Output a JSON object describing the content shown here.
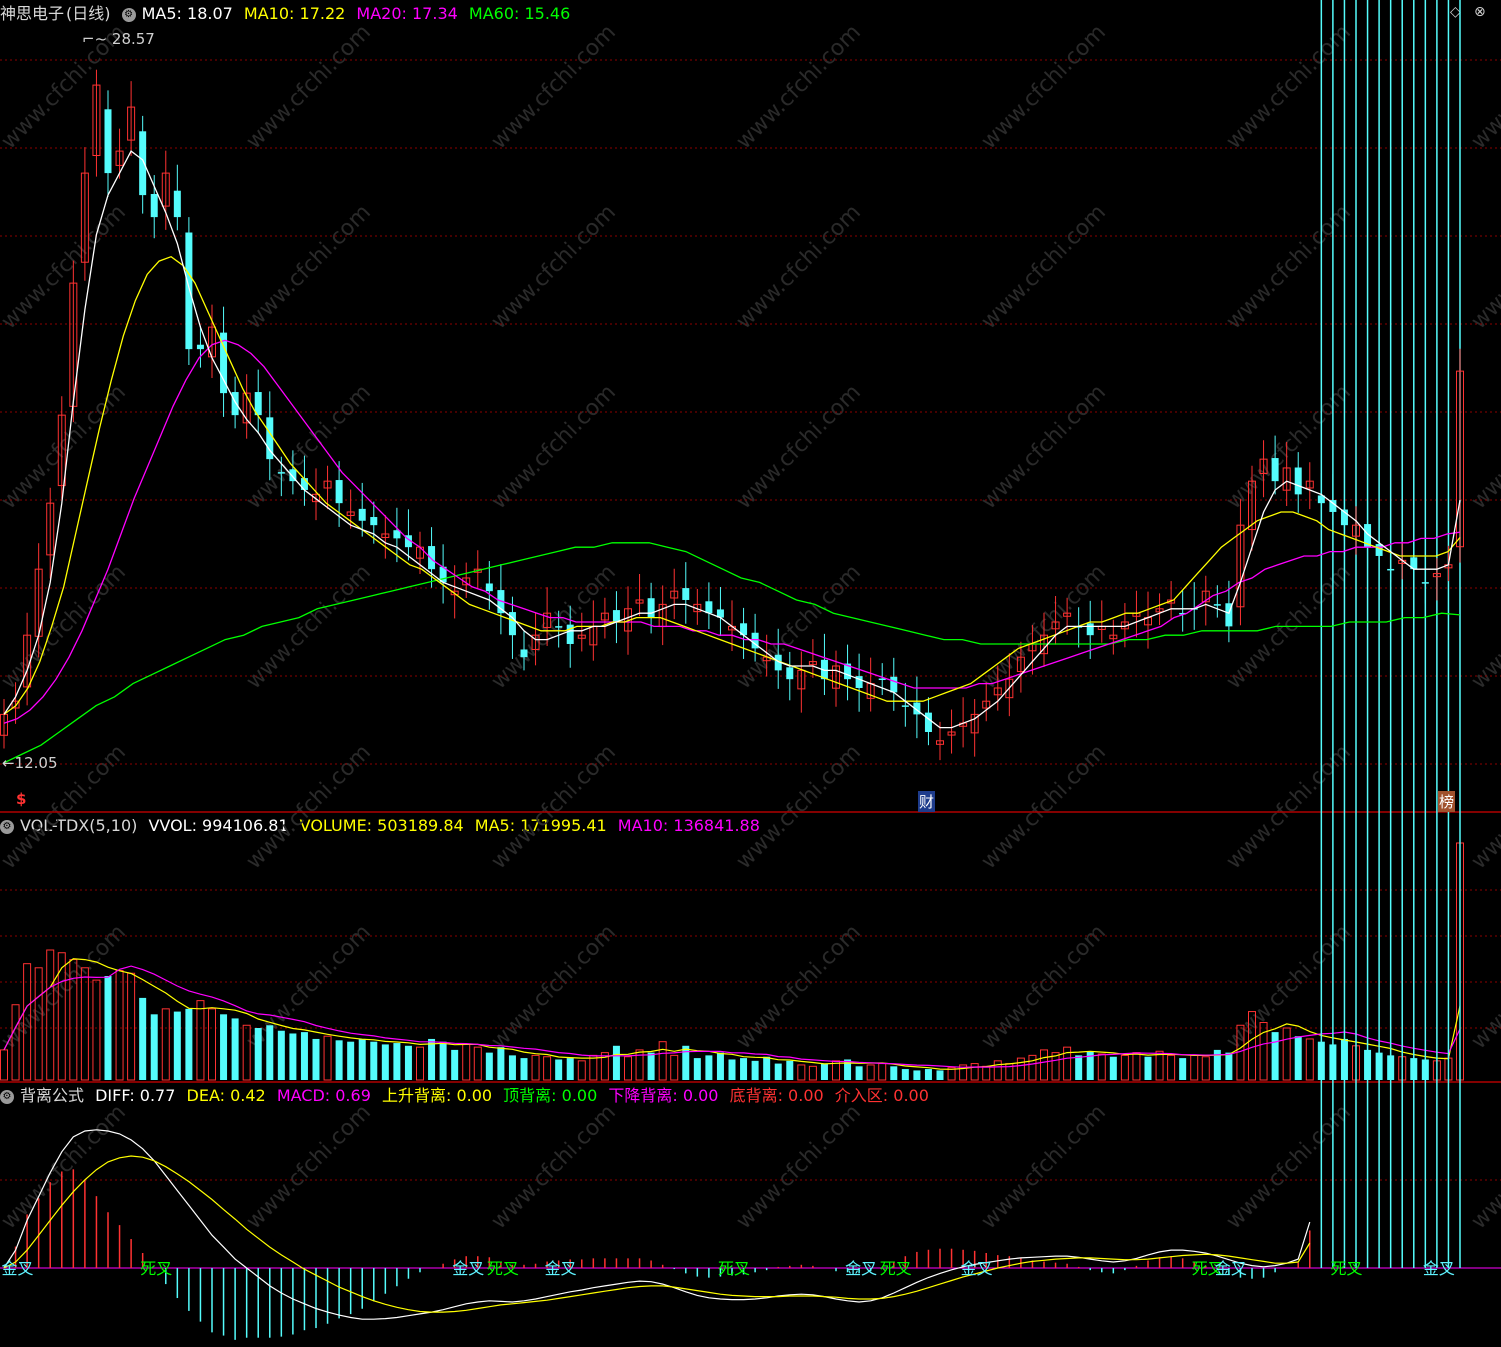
{
  "header": {
    "stock_name": "神思电子",
    "period": "(日线)",
    "ma5": "MA5: 18.07",
    "ma10": "MA10: 17.22",
    "ma20": "MA20: 17.34",
    "ma60": "MA60: 15.46"
  },
  "price_panel": {
    "high_label": "28.57",
    "low_label": "12.05",
    "markers": {
      "dollar": "$",
      "cai": "财",
      "bang": "榜"
    },
    "watermark": "www.cfchi.com"
  },
  "volume_panel": {
    "name": "VOL-TDX(5,10)",
    "vvol": "VVOL: 994106.81",
    "volume": "VOLUME: 503189.84",
    "ma5": "MA5: 171995.41",
    "ma10": "MA10: 136841.88"
  },
  "macd_panel": {
    "name": "背离公式",
    "diff": "DIFF: 0.77",
    "dea": "DEA: 0.42",
    "macd": "MACD: 0.69",
    "up_div": "上升背离: 0.00",
    "top_div": "顶背离: 0.00",
    "down_div": "下降背离: 0.00",
    "bottom_div": "底背离: 0.00",
    "entry_zone": "介入区: 0.00",
    "signals": [
      {
        "text": "金叉",
        "color": "#5ff3ff",
        "i": 1
      },
      {
        "text": "死叉",
        "color": "#00ff00",
        "i": 13
      },
      {
        "text": "金叉",
        "color": "#5ff3ff",
        "i": 40
      },
      {
        "text": "死叉",
        "color": "#00ff00",
        "i": 43
      },
      {
        "text": "金叉",
        "color": "#5ff3ff",
        "i": 48
      },
      {
        "text": "死叉",
        "color": "#00ff00",
        "i": 63
      },
      {
        "text": "金叉",
        "color": "#5ff3ff",
        "i": 74
      },
      {
        "text": "死叉",
        "color": "#00ff00",
        "i": 77
      },
      {
        "text": "金叉",
        "color": "#5ff3ff",
        "i": 84
      },
      {
        "text": "死叉",
        "color": "#00ff00",
        "i": 104
      },
      {
        "text": "金叉",
        "color": "#5ff3ff",
        "i": 106
      },
      {
        "text": "死叉",
        "color": "#00ff00",
        "i": 116
      },
      {
        "text": "金叉",
        "color": "#5ff3ff",
        "i": 124
      }
    ]
  },
  "colors": {
    "up": "#ff3232",
    "down": "#54fcfc",
    "ma5": "#ffffff",
    "ma10": "#ffff00",
    "ma20": "#ff00ff",
    "ma60": "#00ff00",
    "grid": "#8b0000",
    "border": "#b00000"
  },
  "chart_data": {
    "type": "candlestick",
    "bars": 127,
    "ylim_price": [
      12.05,
      28.57
    ],
    "closes": [
      13.2,
      13.5,
      15.0,
      16.5,
      18.0,
      20.0,
      23.0,
      25.5,
      27.5,
      25.5,
      26.0,
      27.0,
      25.0,
      24.5,
      25.5,
      24.5,
      21.5,
      21.5,
      22.0,
      20.5,
      20.0,
      20.5,
      20.0,
      19.0,
      18.7,
      18.5,
      18.3,
      18.2,
      18.5,
      18.0,
      17.8,
      17.6,
      17.5,
      17.3,
      17.2,
      17.0,
      17.0,
      16.5,
      16.2,
      16.0,
      16.3,
      16.5,
      16.0,
      15.5,
      15.0,
      14.5,
      15.0,
      15.5,
      15.2,
      14.8,
      15.0,
      15.2,
      15.5,
      15.3,
      15.6,
      15.8,
      15.4,
      15.7,
      16.0,
      15.8,
      15.7,
      15.5,
      15.4,
      15.2,
      15.0,
      14.7,
      14.5,
      14.2,
      14.0,
      14.2,
      14.4,
      14.0,
      14.3,
      14.0,
      13.8,
      13.9,
      14.0,
      13.7,
      13.4,
      13.2,
      12.8,
      12.6,
      12.8,
      13.0,
      13.2,
      13.5,
      13.8,
      14.0,
      14.5,
      14.8,
      15.0,
      15.3,
      15.5,
      15.2,
      15.0,
      15.2,
      15.0,
      15.3,
      15.5,
      15.4,
      15.6,
      15.8,
      15.5,
      15.6,
      16.0,
      15.7,
      15.2,
      17.5,
      18.5,
      19.0,
      18.5,
      18.8,
      18.2,
      18.5,
      18.0,
      17.8,
      17.5,
      17.5,
      17.0,
      16.8,
      16.5,
      16.7,
      16.5,
      16.2,
      16.4,
      16.6,
      21.0
    ],
    "ma5": [
      13.2,
      13.6,
      14.2,
      15.0,
      16.2,
      18.0,
      20.3,
      22.4,
      24.1,
      25.0,
      25.5,
      26.0,
      25.8,
      25.2,
      24.6,
      23.9,
      22.9,
      22.0,
      21.3,
      20.8,
      20.3,
      19.9,
      19.6,
      19.2,
      18.9,
      18.6,
      18.3,
      18.1,
      17.9,
      17.7,
      17.5,
      17.4,
      17.3,
      17.1,
      17.0,
      16.8,
      16.6,
      16.4,
      16.2,
      16.1,
      16.0,
      15.9,
      15.8,
      15.6,
      15.4,
      15.1,
      14.9,
      14.9,
      15.0,
      15.1,
      15.1,
      15.2,
      15.2,
      15.3,
      15.4,
      15.5,
      15.5,
      15.6,
      15.7,
      15.7,
      15.6,
      15.5,
      15.4,
      15.2,
      15.0,
      14.8,
      14.6,
      14.4,
      14.3,
      14.3,
      14.3,
      14.2,
      14.2,
      14.1,
      14.0,
      13.9,
      13.8,
      13.7,
      13.5,
      13.3,
      13.1,
      12.9,
      12.9,
      13.0,
      13.1,
      13.3,
      13.5,
      13.8,
      14.1,
      14.4,
      14.7,
      15.0,
      15.2,
      15.2,
      15.2,
      15.2,
      15.2,
      15.2,
      15.3,
      15.4,
      15.5,
      15.6,
      15.6,
      15.6,
      15.7,
      15.6,
      15.5,
      16.2,
      17.0,
      17.8,
      18.3,
      18.5,
      18.4,
      18.3,
      18.2,
      18.0,
      17.8,
      17.6,
      17.3,
      17.1,
      16.9,
      16.7,
      16.5,
      16.5,
      16.5,
      16.6,
      18.07
    ],
    "ma10": [
      13.2,
      13.4,
      13.8,
      14.4,
      15.2,
      16.1,
      17.3,
      18.5,
      19.7,
      20.8,
      21.8,
      22.6,
      23.2,
      23.5,
      23.6,
      23.4,
      23.0,
      22.4,
      21.8,
      21.2,
      20.6,
      20.1,
      19.7,
      19.3,
      18.9,
      18.6,
      18.3,
      18.0,
      17.8,
      17.6,
      17.4,
      17.2,
      17.0,
      16.8,
      16.6,
      16.5,
      16.3,
      16.1,
      15.9,
      15.7,
      15.6,
      15.5,
      15.4,
      15.3,
      15.2,
      15.1,
      15.1,
      15.1,
      15.2,
      15.2,
      15.2,
      15.3,
      15.3,
      15.4,
      15.4,
      15.4,
      15.3,
      15.2,
      15.1,
      15.0,
      14.9,
      14.8,
      14.7,
      14.6,
      14.5,
      14.4,
      14.3,
      14.2,
      14.1,
      14.0,
      13.9,
      13.8,
      13.7,
      13.6,
      13.5,
      13.5,
      13.5,
      13.5,
      13.6,
      13.7,
      13.8,
      13.9,
      14.1,
      14.3,
      14.5,
      14.7,
      14.8,
      14.9,
      15.0,
      15.1,
      15.2,
      15.3,
      15.3,
      15.4,
      15.5,
      15.5,
      15.6,
      15.7,
      15.8,
      16.1,
      16.4,
      16.7,
      17.0,
      17.2,
      17.4,
      17.6,
      17.7,
      17.8,
      17.8,
      17.7,
      17.6,
      17.4,
      17.3,
      17.2,
      17.1,
      17.0,
      16.9,
      16.8,
      16.8,
      16.8,
      16.8,
      16.9,
      17.22
    ],
    "ma20": [
      13.0,
      13.1,
      13.3,
      13.6,
      14.0,
      14.5,
      15.1,
      15.8,
      16.5,
      17.3,
      18.1,
      18.8,
      19.5,
      20.2,
      20.8,
      21.3,
      21.6,
      21.7,
      21.6,
      21.4,
      21.1,
      20.7,
      20.3,
      19.9,
      19.5,
      19.1,
      18.7,
      18.4,
      18.1,
      17.8,
      17.5,
      17.2,
      17.0,
      16.7,
      16.5,
      16.3,
      16.1,
      16.0,
      15.8,
      15.7,
      15.6,
      15.5,
      15.4,
      15.4,
      15.3,
      15.3,
      15.3,
      15.3,
      15.3,
      15.3,
      15.2,
      15.2,
      15.2,
      15.1,
      15.1,
      15.0,
      15.0,
      14.9,
      14.9,
      14.8,
      14.8,
      14.7,
      14.6,
      14.5,
      14.4,
      14.3,
      14.2,
      14.1,
      14.0,
      13.9,
      13.8,
      13.8,
      13.8,
      13.8,
      13.8,
      13.9,
      13.9,
      14.0,
      14.1,
      14.2,
      14.3,
      14.4,
      14.5,
      14.6,
      14.7,
      14.8,
      14.9,
      15.0,
      15.1,
      15.2,
      15.4,
      15.5,
      15.7,
      15.9,
      16.0,
      16.2,
      16.3,
      16.5,
      16.6,
      16.7,
      16.8,
      16.8,
      16.9,
      16.9,
      17.0,
      17.0,
      17.0,
      17.1,
      17.1,
      17.2,
      17.2,
      17.3,
      17.34
    ],
    "ma60": [
      12.1,
      12.3,
      12.5,
      12.8,
      13.1,
      13.4,
      13.6,
      13.9,
      14.1,
      14.3,
      14.5,
      14.7,
      14.9,
      15.0,
      15.2,
      15.3,
      15.4,
      15.6,
      15.7,
      15.8,
      15.9,
      16.0,
      16.1,
      16.2,
      16.3,
      16.4,
      16.5,
      16.6,
      16.7,
      16.8,
      16.9,
      17.0,
      17.0,
      17.1,
      17.1,
      17.1,
      17.0,
      16.9,
      16.7,
      16.5,
      16.3,
      16.2,
      16.0,
      15.8,
      15.7,
      15.5,
      15.4,
      15.3,
      15.2,
      15.1,
      15.0,
      14.9,
      14.9,
      14.8,
      14.8,
      14.8,
      14.8,
      14.8,
      14.8,
      14.8,
      14.8,
      14.9,
      14.9,
      15.0,
      15.0,
      15.1,
      15.1,
      15.1,
      15.1,
      15.2,
      15.2,
      15.2,
      15.2,
      15.3,
      15.3,
      15.3,
      15.4,
      15.4,
      15.5,
      15.46
    ],
    "volume": [
      0.22,
      0.55,
      0.85,
      0.82,
      0.95,
      0.93,
      0.88,
      0.82,
      0.73,
      0.76,
      0.8,
      0.78,
      0.6,
      0.48,
      0.52,
      0.5,
      0.52,
      0.58,
      0.52,
      0.48,
      0.45,
      0.4,
      0.38,
      0.4,
      0.36,
      0.34,
      0.35,
      0.3,
      0.32,
      0.29,
      0.28,
      0.3,
      0.28,
      0.26,
      0.27,
      0.25,
      0.24,
      0.3,
      0.28,
      0.22,
      0.26,
      0.24,
      0.2,
      0.24,
      0.18,
      0.16,
      0.18,
      0.17,
      0.15,
      0.16,
      0.14,
      0.18,
      0.2,
      0.25,
      0.17,
      0.22,
      0.2,
      0.28,
      0.18,
      0.25,
      0.16,
      0.18,
      0.2,
      0.15,
      0.16,
      0.14,
      0.17,
      0.12,
      0.14,
      0.11,
      0.1,
      0.12,
      0.14,
      0.15,
      0.1,
      0.11,
      0.12,
      0.1,
      0.08,
      0.07,
      0.08,
      0.07,
      0.09,
      0.11,
      0.12,
      0.1,
      0.14,
      0.12,
      0.16,
      0.18,
      0.22,
      0.2,
      0.24,
      0.18,
      0.21,
      0.19,
      0.17,
      0.18,
      0.2,
      0.17,
      0.21,
      0.18,
      0.16,
      0.18,
      0.17,
      0.22,
      0.2,
      0.4,
      0.5,
      0.42,
      0.35,
      0.38,
      0.32,
      0.3,
      0.28,
      0.26,
      0.3,
      0.25,
      0.22,
      0.2,
      0.18,
      0.17,
      0.16,
      0.15,
      0.14,
      0.16,
      2.1
    ],
    "diff": [
      0.0,
      0.3,
      0.8,
      1.2,
      1.6,
      1.95,
      2.2,
      2.3,
      2.32,
      2.3,
      2.25,
      2.15,
      2.0,
      1.8,
      1.55,
      1.3,
      1.05,
      0.8,
      0.55,
      0.35,
      0.15,
      0.0,
      -0.15,
      -0.3,
      -0.42,
      -0.52,
      -0.6,
      -0.68,
      -0.74,
      -0.79,
      -0.83,
      -0.86,
      -0.86,
      -0.85,
      -0.83,
      -0.8,
      -0.77,
      -0.74,
      -0.7,
      -0.65,
      -0.6,
      -0.57,
      -0.55,
      -0.56,
      -0.57,
      -0.55,
      -0.52,
      -0.48,
      -0.44,
      -0.4,
      -0.37,
      -0.33,
      -0.3,
      -0.27,
      -0.24,
      -0.22,
      -0.23,
      -0.27,
      -0.33,
      -0.4,
      -0.46,
      -0.5,
      -0.52,
      -0.53,
      -0.53,
      -0.52,
      -0.5,
      -0.47,
      -0.45,
      -0.44,
      -0.45,
      -0.48,
      -0.52,
      -0.55,
      -0.57,
      -0.55,
      -0.5,
      -0.42,
      -0.33,
      -0.24,
      -0.16,
      -0.09,
      -0.03,
      0.02,
      0.06,
      0.09,
      0.12,
      0.15,
      0.17,
      0.18,
      0.19,
      0.2,
      0.2,
      0.18,
      0.15,
      0.12,
      0.1,
      0.12,
      0.16,
      0.22,
      0.27,
      0.3,
      0.3,
      0.28,
      0.25,
      0.2,
      0.14,
      0.08,
      0.04,
      0.02,
      0.04,
      0.08,
      0.15,
      0.77
    ],
    "dea": [
      0.0,
      0.1,
      0.3,
      0.55,
      0.8,
      1.05,
      1.28,
      1.48,
      1.65,
      1.78,
      1.85,
      1.88,
      1.86,
      1.8,
      1.7,
      1.58,
      1.45,
      1.3,
      1.15,
      0.98,
      0.82,
      0.65,
      0.5,
      0.35,
      0.22,
      0.1,
      -0.02,
      -0.12,
      -0.22,
      -0.32,
      -0.4,
      -0.48,
      -0.55,
      -0.61,
      -0.66,
      -0.7,
      -0.73,
      -0.74,
      -0.74,
      -0.73,
      -0.71,
      -0.68,
      -0.65,
      -0.62,
      -0.6,
      -0.58,
      -0.56,
      -0.54,
      -0.51,
      -0.48,
      -0.45,
      -0.42,
      -0.39,
      -0.36,
      -0.33,
      -0.31,
      -0.3,
      -0.3,
      -0.32,
      -0.35,
      -0.38,
      -0.41,
      -0.44,
      -0.46,
      -0.47,
      -0.48,
      -0.48,
      -0.48,
      -0.47,
      -0.47,
      -0.47,
      -0.48,
      -0.49,
      -0.51,
      -0.52,
      -0.52,
      -0.51,
      -0.48,
      -0.44,
      -0.39,
      -0.33,
      -0.27,
      -0.21,
      -0.15,
      -0.1,
      -0.05,
      0.0,
      0.04,
      0.08,
      0.11,
      0.13,
      0.15,
      0.16,
      0.17,
      0.17,
      0.16,
      0.15,
      0.14,
      0.14,
      0.15,
      0.17,
      0.19,
      0.21,
      0.22,
      0.23,
      0.22,
      0.2,
      0.17,
      0.14,
      0.11,
      0.08,
      0.08,
      0.1,
      0.42
    ]
  }
}
